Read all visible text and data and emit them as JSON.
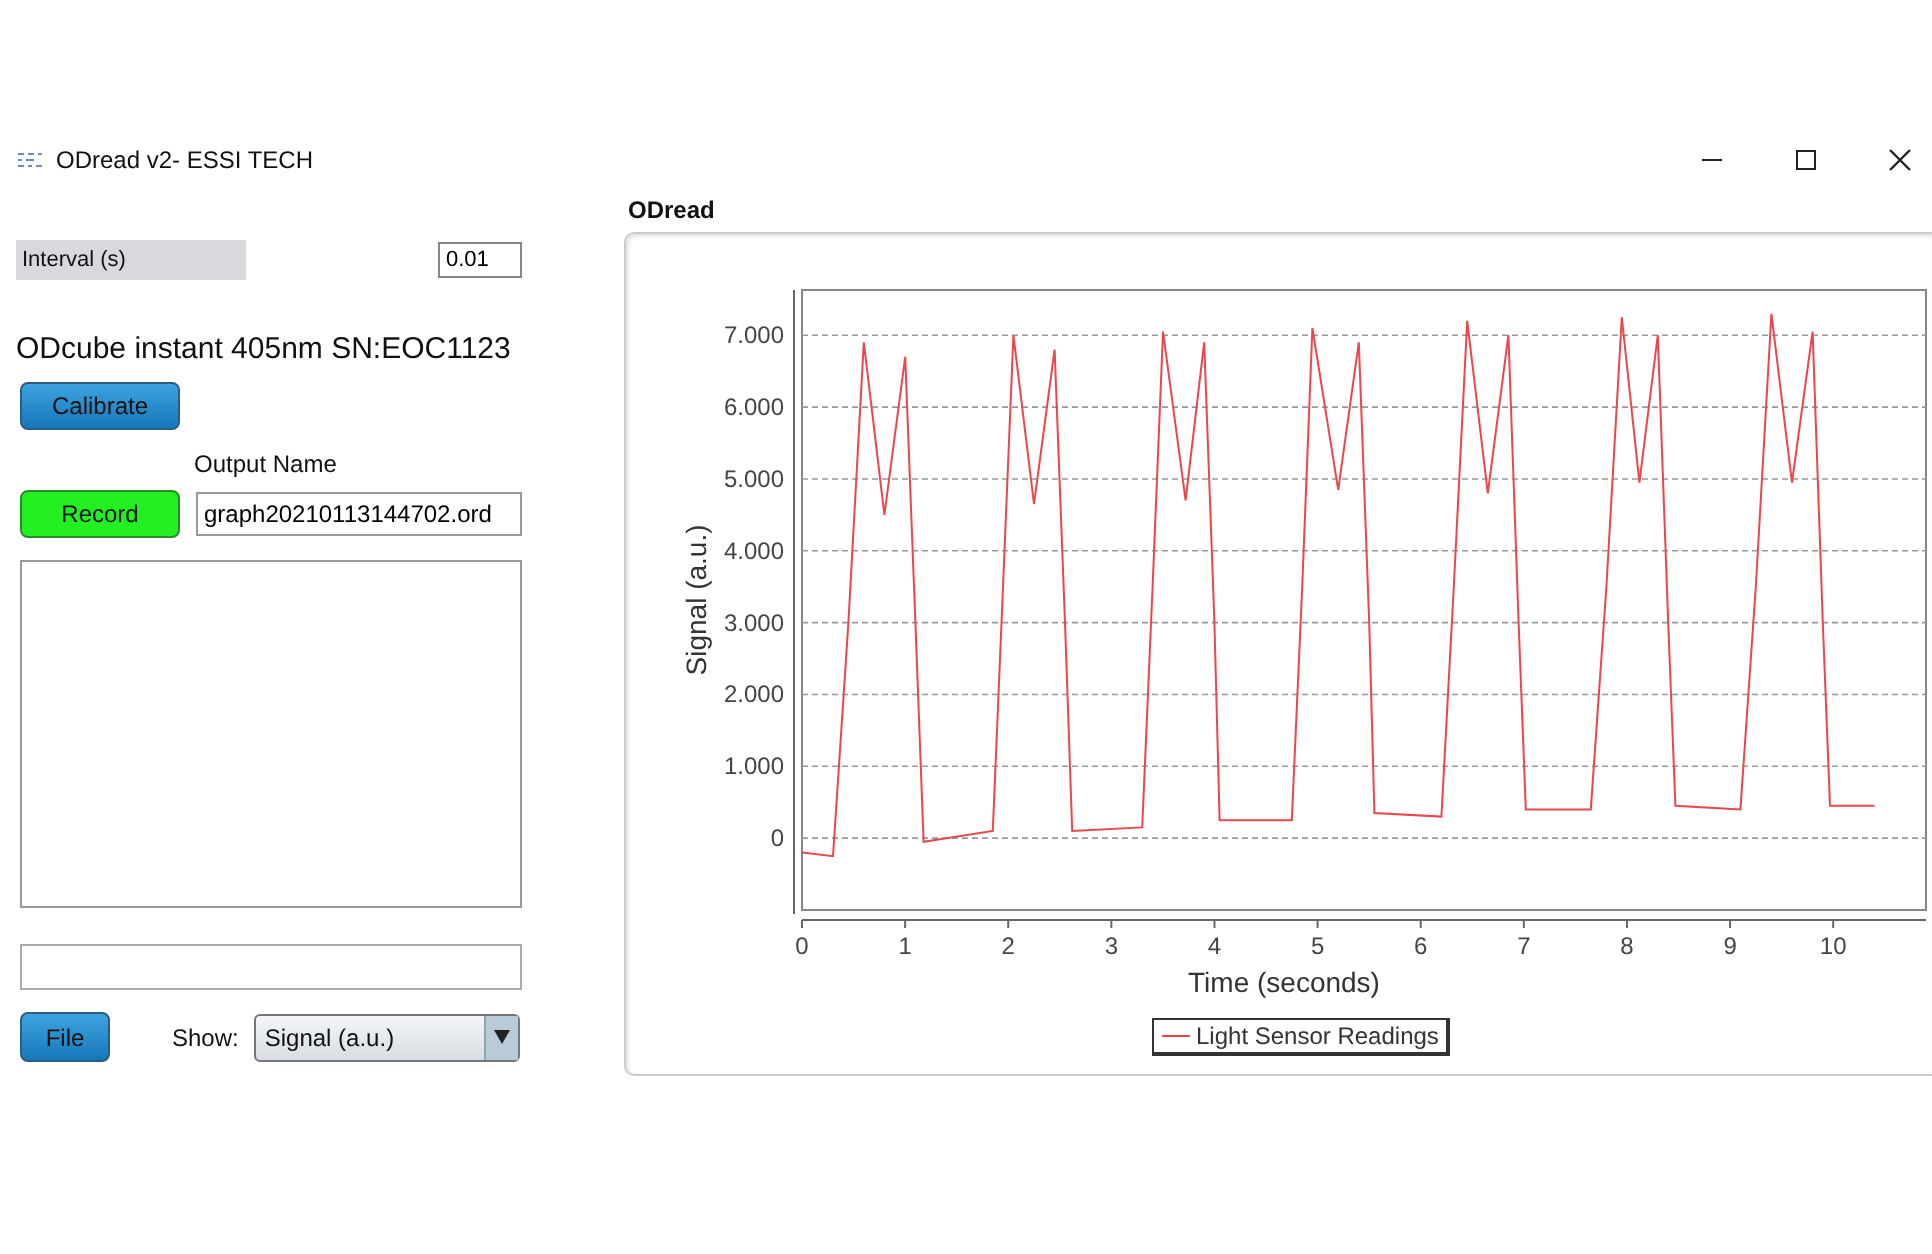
{
  "window": {
    "title": "ODread v2- ESSI TECH"
  },
  "controls": {
    "interval": {
      "label": "Interval (s)",
      "value": "0.01"
    },
    "device_label": "ODcube instant 405nm SN:EOC1123",
    "calibrate_button": "Calibrate",
    "output_name": {
      "label": "Output Name",
      "value": "graph20210113144702.ord"
    },
    "record_button": "Record",
    "file_button": "File",
    "show": {
      "label": "Show:",
      "value": "Signal (a.u.)"
    }
  },
  "chart_panel": {
    "title": "ODread",
    "chart_data": {
      "type": "line",
      "xlabel": "Time (seconds)",
      "ylabel": "Signal (a.u.)",
      "x": [
        0,
        0.3,
        0.45,
        0.6,
        0.8,
        1.0,
        1.1,
        1.18,
        1.85,
        1.95,
        2.05,
        2.25,
        2.45,
        2.55,
        2.62,
        3.3,
        3.4,
        3.5,
        3.72,
        3.9,
        4.0,
        4.05,
        4.75,
        4.85,
        4.95,
        5.2,
        5.4,
        5.5,
        5.55,
        6.2,
        6.32,
        6.45,
        6.65,
        6.85,
        6.95,
        7.02,
        7.65,
        7.8,
        7.95,
        8.12,
        8.3,
        8.4,
        8.47,
        9.1,
        9.25,
        9.4,
        9.6,
        9.8,
        9.9,
        9.97,
        10.4
      ],
      "series": [
        {
          "name": "Light Sensor Readings",
          "color": "#e8474c",
          "values": [
            -0.2,
            -0.25,
            3.0,
            6.9,
            4.5,
            6.7,
            3.0,
            -0.05,
            0.1,
            3.5,
            7.0,
            4.65,
            6.8,
            3.0,
            0.1,
            0.15,
            3.5,
            7.05,
            4.7,
            6.9,
            3.0,
            0.25,
            0.25,
            3.5,
            7.1,
            4.85,
            6.9,
            3.0,
            0.35,
            0.3,
            3.5,
            7.2,
            4.8,
            7.0,
            3.0,
            0.4,
            0.4,
            3.5,
            7.25,
            4.95,
            7.0,
            3.0,
            0.45,
            0.4,
            3.5,
            7.3,
            4.95,
            7.05,
            3.0,
            0.45,
            0.45
          ]
        }
      ],
      "grid": true,
      "xlim": [
        0,
        10.9
      ],
      "ylim": [
        -1,
        7.63
      ],
      "xticks": [
        0,
        1,
        2,
        3,
        4,
        5,
        6,
        7,
        8,
        9,
        10
      ],
      "yticks": [
        {
          "value": 0,
          "label": "0"
        },
        {
          "value": 1,
          "label": "1.000"
        },
        {
          "value": 2,
          "label": "2.000"
        },
        {
          "value": 3,
          "label": "3.000"
        },
        {
          "value": 4,
          "label": "4.000"
        },
        {
          "value": 5,
          "label": "5.000"
        },
        {
          "value": 6,
          "label": "6.000"
        },
        {
          "value": 7,
          "label": "7.000"
        }
      ]
    }
  }
}
